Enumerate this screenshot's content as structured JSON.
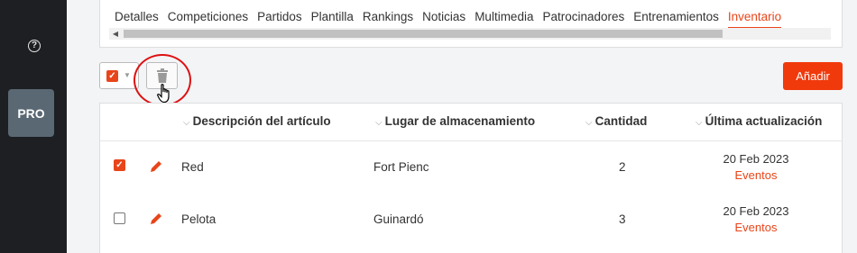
{
  "sidebar": {
    "help_icon": "question-circle-icon",
    "help_glyph": "?",
    "pro_label": "PRO"
  },
  "tabs": [
    {
      "label": "Detalles"
    },
    {
      "label": "Competiciones"
    },
    {
      "label": "Partidos"
    },
    {
      "label": "Plantilla"
    },
    {
      "label": "Rankings"
    },
    {
      "label": "Noticias"
    },
    {
      "label": "Multimedia"
    },
    {
      "label": "Patrocinadores"
    },
    {
      "label": "Entrenamientos"
    },
    {
      "label": "Inventario",
      "active": true
    }
  ],
  "toolbar": {
    "add_label": "Añadir",
    "checkmark": "✓",
    "caret": "▼",
    "scroll_left": "◀"
  },
  "table": {
    "columns": {
      "description": "Descripción del artículo",
      "location": "Lugar de almacenamiento",
      "quantity": "Cantidad",
      "updated": "Última actualización"
    },
    "sort_glyph": "⌵",
    "rows": [
      {
        "checked": true,
        "description": "Red",
        "location": "Fort Pienc",
        "quantity": "2",
        "date": "20 Feb 2023",
        "link": "Eventos"
      },
      {
        "checked": false,
        "description": "Pelota",
        "location": "Guinardó",
        "quantity": "3",
        "date": "20 Feb 2023",
        "link": "Eventos"
      }
    ]
  },
  "colors": {
    "accent": "#e8451a",
    "button": "#f03a0c",
    "sidebar": "#1d1f22",
    "pro": "#5a6874",
    "highlight": "#dd1111"
  }
}
